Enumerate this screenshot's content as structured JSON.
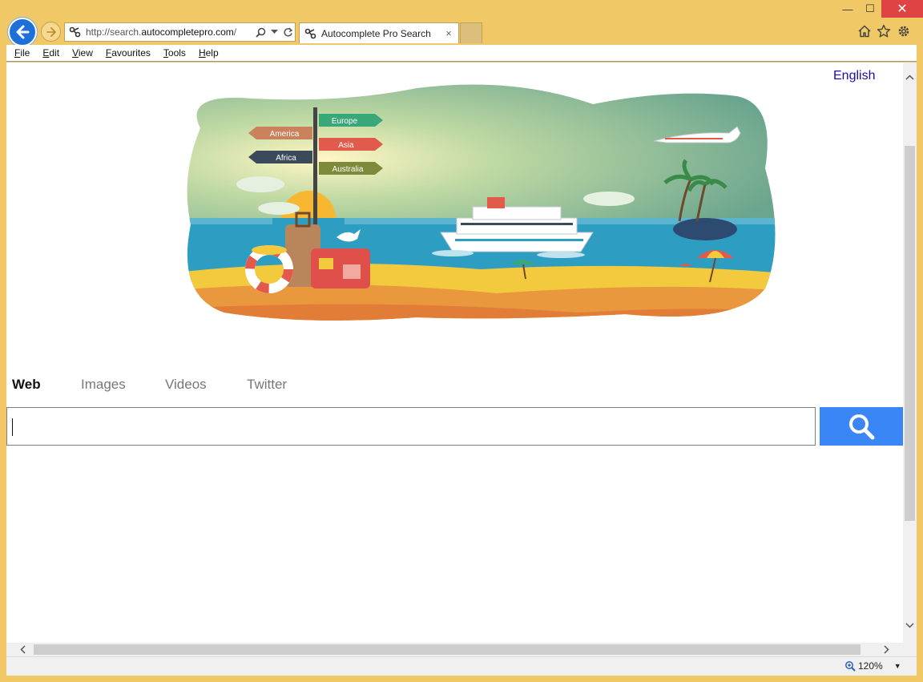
{
  "window": {
    "minimize_glyph": "—",
    "maximize_glyph": "☐",
    "close_glyph": "✕"
  },
  "address": {
    "url_prefix": "http://search.",
    "url_domain": "autocompletepro.com",
    "url_suffix": "/"
  },
  "tabs": [
    {
      "title": "Autocomplete Pro Search",
      "close_glyph": "×"
    }
  ],
  "menu": [
    {
      "label": "File",
      "accel": "F",
      "rest": "ile"
    },
    {
      "label": "Edit",
      "accel": "E",
      "rest": "dit"
    },
    {
      "label": "View",
      "accel": "V",
      "rest": "iew"
    },
    {
      "label": "Favourites",
      "accel": "F",
      "rest": "avourites"
    },
    {
      "label": "Tools",
      "accel": "T",
      "rest": "ools"
    },
    {
      "label": "Help",
      "accel": "H",
      "rest": "elp"
    }
  ],
  "page": {
    "language_link": "English",
    "hero_signs": [
      "Europe",
      "America",
      "Asia",
      "Africa",
      "Australia"
    ],
    "search_tabs": [
      "Web",
      "Images",
      "Videos",
      "Twitter"
    ],
    "active_search_tab": "Web",
    "search_value": "",
    "search_placeholder": ""
  },
  "status": {
    "zoom": "120%",
    "zoom_caret": "▼"
  },
  "colors": {
    "frame": "#f0c866",
    "search_button": "#3a86f6",
    "link": "#1a0dab",
    "close_button": "#e04343"
  },
  "icons": [
    "back-icon",
    "forward-icon",
    "site-favicon",
    "search-icon",
    "dropdown-icon",
    "refresh-icon",
    "home-icon",
    "favorites-star-icon",
    "settings-gear-icon",
    "zoom-icon"
  ]
}
